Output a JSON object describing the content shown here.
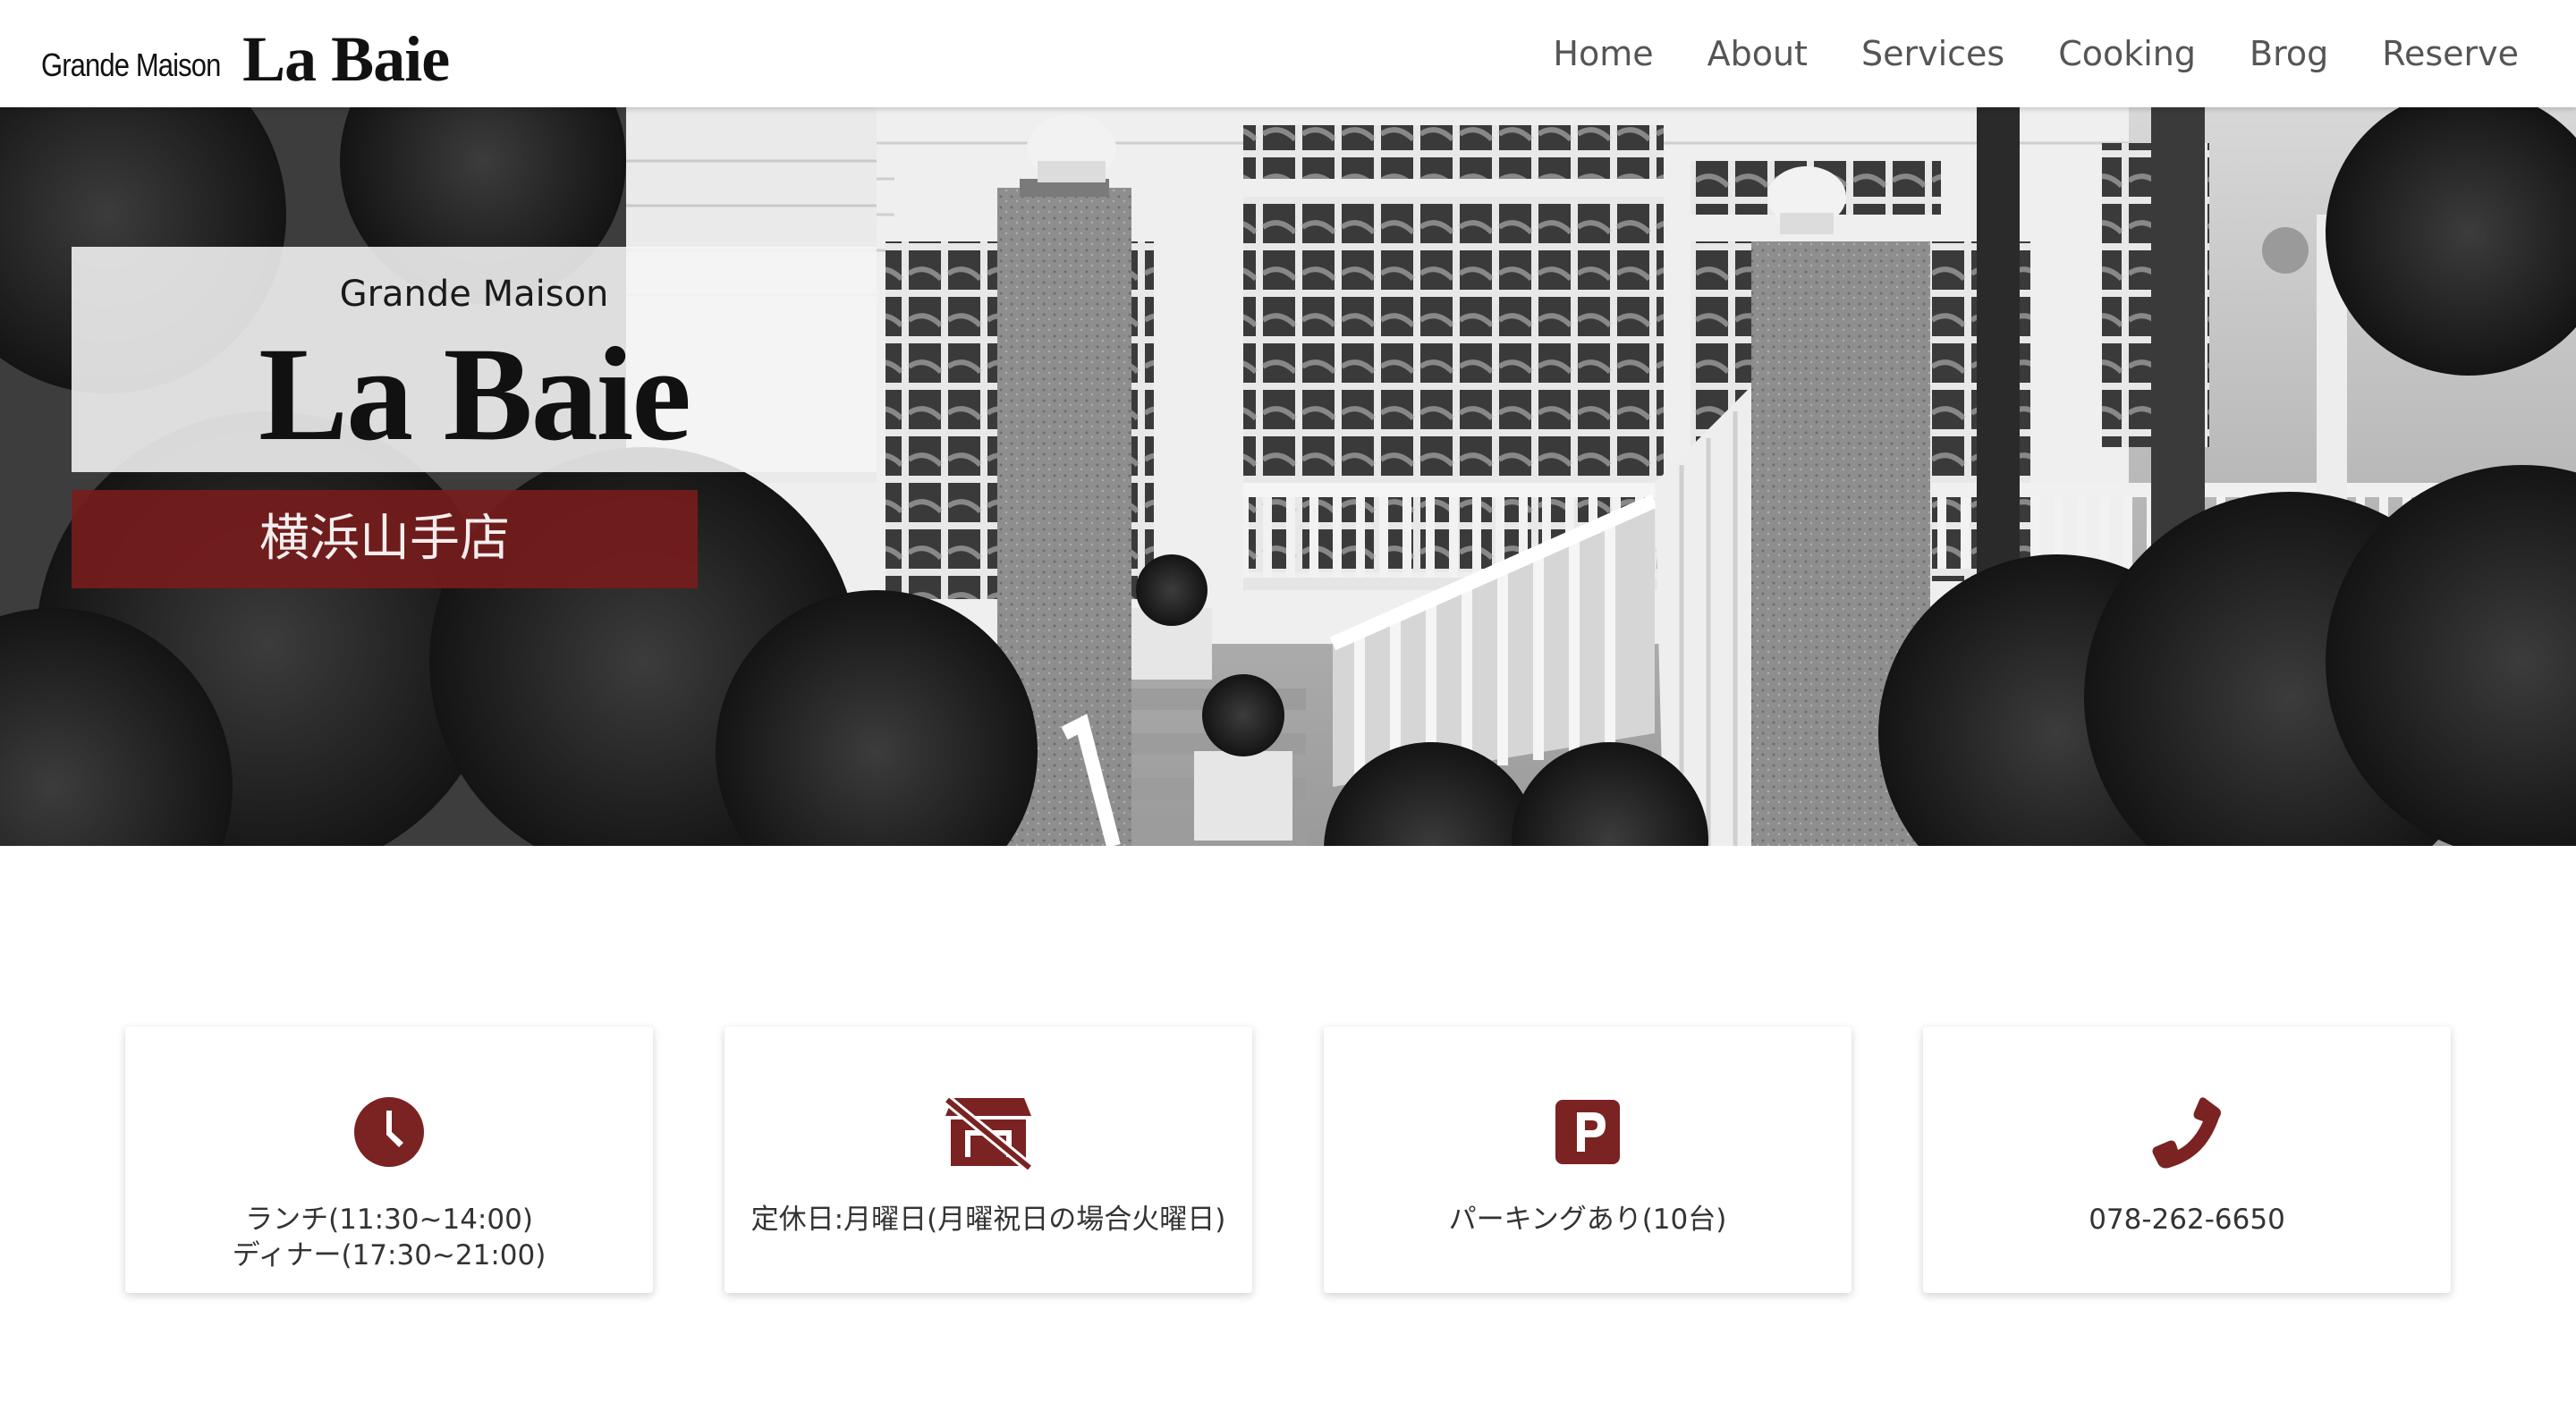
{
  "header": {
    "logo_small": "Grande Maison",
    "logo_big": "La Baie",
    "nav": [
      {
        "label": "Home"
      },
      {
        "label": "About"
      },
      {
        "label": "Services"
      },
      {
        "label": "Cooking"
      },
      {
        "label": "Brog"
      },
      {
        "label": "Reserve"
      }
    ]
  },
  "hero": {
    "brand_sub": "Grande Maison",
    "brand_name": "La Baie",
    "branch": "横浜山手店"
  },
  "info": {
    "hours_line1": "ランチ(11:30~14:00)",
    "hours_line2": "ディナー(17:30~21:00)",
    "closed": "定休日:月曜日(月曜祝日の場合火曜日)",
    "parking": "パーキングあり(10台)",
    "phone": "078-262-6650"
  },
  "colors": {
    "accent": "#7b2222",
    "branch_bg": "#781c1c",
    "nav_text": "#555555"
  },
  "icons": [
    "clock-icon",
    "store-closed-icon",
    "parking-icon",
    "phone-icon"
  ]
}
